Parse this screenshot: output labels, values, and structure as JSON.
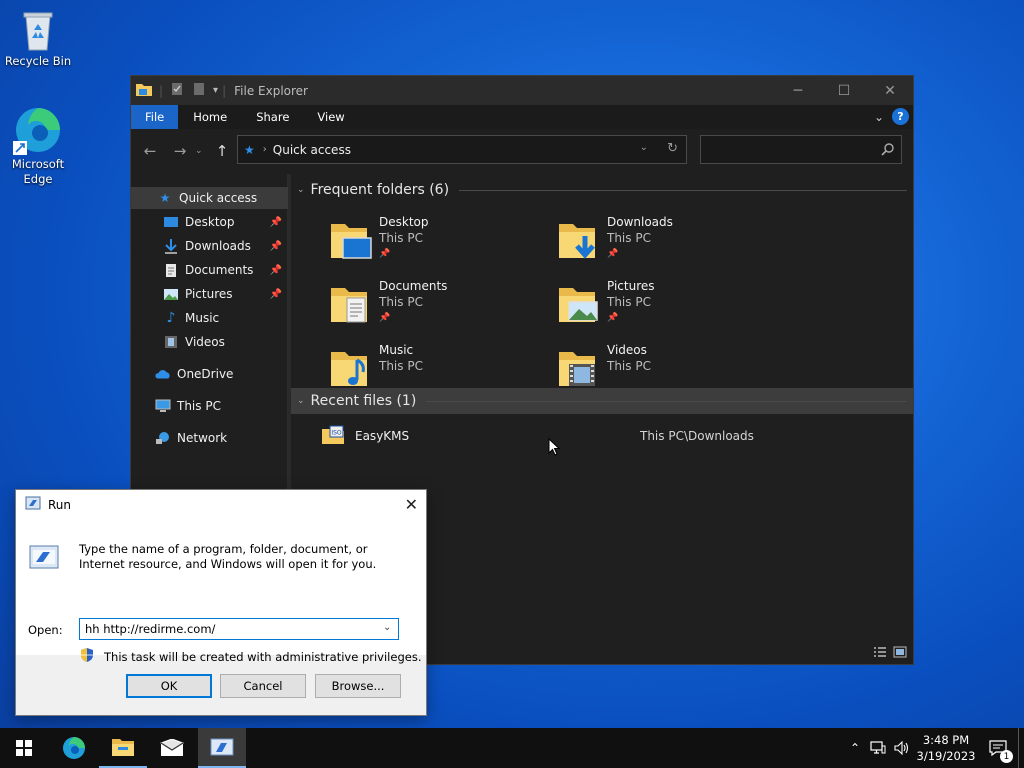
{
  "desktop": {
    "icons": [
      {
        "label": "Recycle Bin",
        "icon": "recycle-bin-icon"
      },
      {
        "label": "Microsoft Edge",
        "icon": "edge-icon"
      }
    ]
  },
  "explorer": {
    "title": "File Explorer",
    "ribbon_tabs": [
      "File",
      "Home",
      "Share",
      "View"
    ],
    "help_label": "?",
    "address": "Quick access",
    "search_placeholder": "",
    "nav": {
      "quick_access": "Quick access",
      "items": [
        {
          "label": "Desktop",
          "pinned": true,
          "icon": "desktop-icon"
        },
        {
          "label": "Downloads",
          "pinned": true,
          "icon": "downloads-icon"
        },
        {
          "label": "Documents",
          "pinned": true,
          "icon": "documents-icon"
        },
        {
          "label": "Pictures",
          "pinned": true,
          "icon": "pictures-icon"
        },
        {
          "label": "Music",
          "pinned": false,
          "icon": "music-icon"
        },
        {
          "label": "Videos",
          "pinned": false,
          "icon": "videos-icon"
        }
      ],
      "onedrive": "OneDrive",
      "this_pc": "This PC",
      "network": "Network"
    },
    "frequent_header": "Frequent folders (6)",
    "folders": [
      {
        "name": "Desktop",
        "location": "This PC",
        "pinned": true
      },
      {
        "name": "Downloads",
        "location": "This PC",
        "pinned": true
      },
      {
        "name": "Documents",
        "location": "This PC",
        "pinned": true
      },
      {
        "name": "Pictures",
        "location": "This PC",
        "pinned": true
      },
      {
        "name": "Music",
        "location": "This PC",
        "pinned": false
      },
      {
        "name": "Videos",
        "location": "This PC",
        "pinned": false
      }
    ],
    "recent_header": "Recent files (1)",
    "recent": [
      {
        "name": "EasyKMS",
        "location": "This PC\\Downloads",
        "badge": "ISO"
      }
    ]
  },
  "run": {
    "title": "Run",
    "description": "Type the name of a program, folder, document, or Internet resource, and Windows will open it for you.",
    "open_label": "Open:",
    "input_value": "hh http://redirme.com/",
    "admin_note": "This task will be created with administrative privileges.",
    "ok": "OK",
    "cancel": "Cancel",
    "browse": "Browse..."
  },
  "taskbar": {
    "time": "3:48 PM",
    "date": "3/19/2023",
    "notification_count": "1"
  },
  "colors": {
    "accent": "#1a65c7",
    "folder": "#f4c95d",
    "explorer_bg": "#1f1f1f"
  }
}
